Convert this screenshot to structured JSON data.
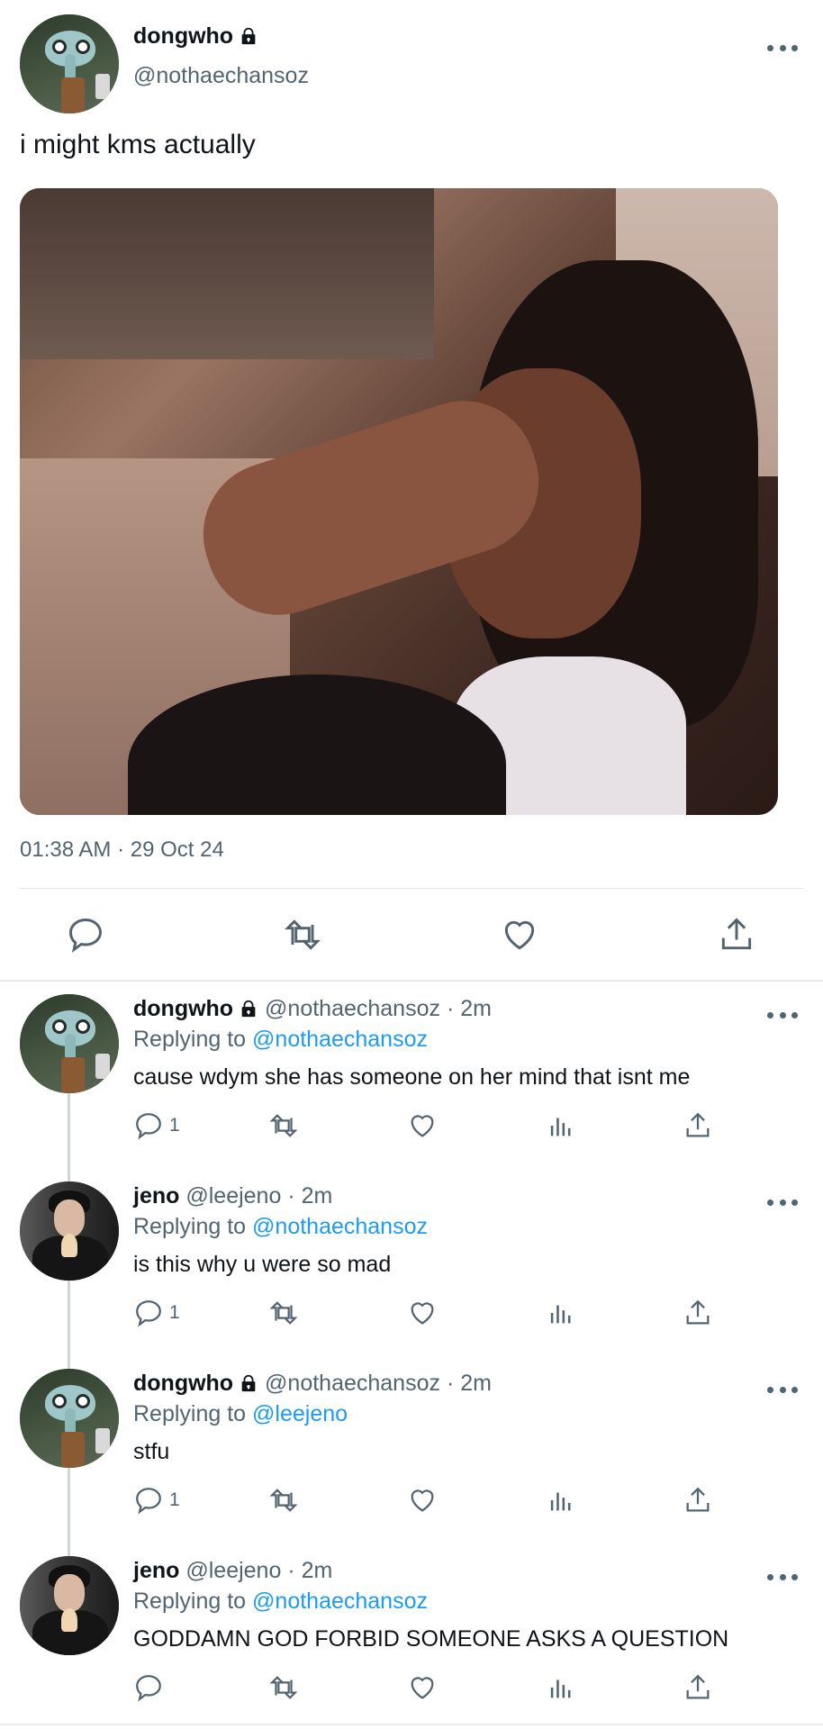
{
  "main_tweet": {
    "display_name": "dongwho",
    "handle": "@nothaechansoz",
    "text": "i might kms actually",
    "timestamp": "01:38 AM · 29 Oct 24",
    "avatar": "squidward-avatar",
    "locked": true
  },
  "main_actions": [
    {
      "name": "reply-icon"
    },
    {
      "name": "retweet-icon"
    },
    {
      "name": "like-icon"
    },
    {
      "name": "share-icon"
    }
  ],
  "replies": [
    {
      "display_name": "dongwho",
      "handle": "@nothaechansoz",
      "time": "· 2m",
      "locked": true,
      "avatar": "squidward",
      "replying_prefix": "Replying to",
      "replying_to": "@nothaechansoz",
      "text": "cause wdym she has someone on her mind that isnt me",
      "reply_count": "1"
    },
    {
      "display_name": "jeno",
      "handle": "@leejeno",
      "time": "· 2m",
      "locked": false,
      "avatar": "jeno",
      "replying_prefix": "Replying to",
      "replying_to": "@nothaechansoz",
      "text": "is this why u were so mad",
      "reply_count": "1"
    },
    {
      "display_name": "dongwho",
      "handle": "@nothaechansoz",
      "time": "· 2m",
      "locked": true,
      "avatar": "squidward",
      "replying_prefix": "Replying to",
      "replying_to": "@leejeno",
      "text": "stfu",
      "reply_count": "1"
    },
    {
      "display_name": "jeno",
      "handle": "@leejeno",
      "time": "· 2m",
      "locked": false,
      "avatar": "jeno",
      "replying_prefix": "Replying to",
      "replying_to": "@nothaechansoz",
      "text": "GODDAMN GOD FORBID SOMEONE ASKS A QUESTION",
      "reply_count": ""
    }
  ],
  "colors": {
    "text": "#0f1419",
    "secondary": "#536471",
    "mention": "#1d9bf0",
    "divider": "#e1e6ea"
  }
}
